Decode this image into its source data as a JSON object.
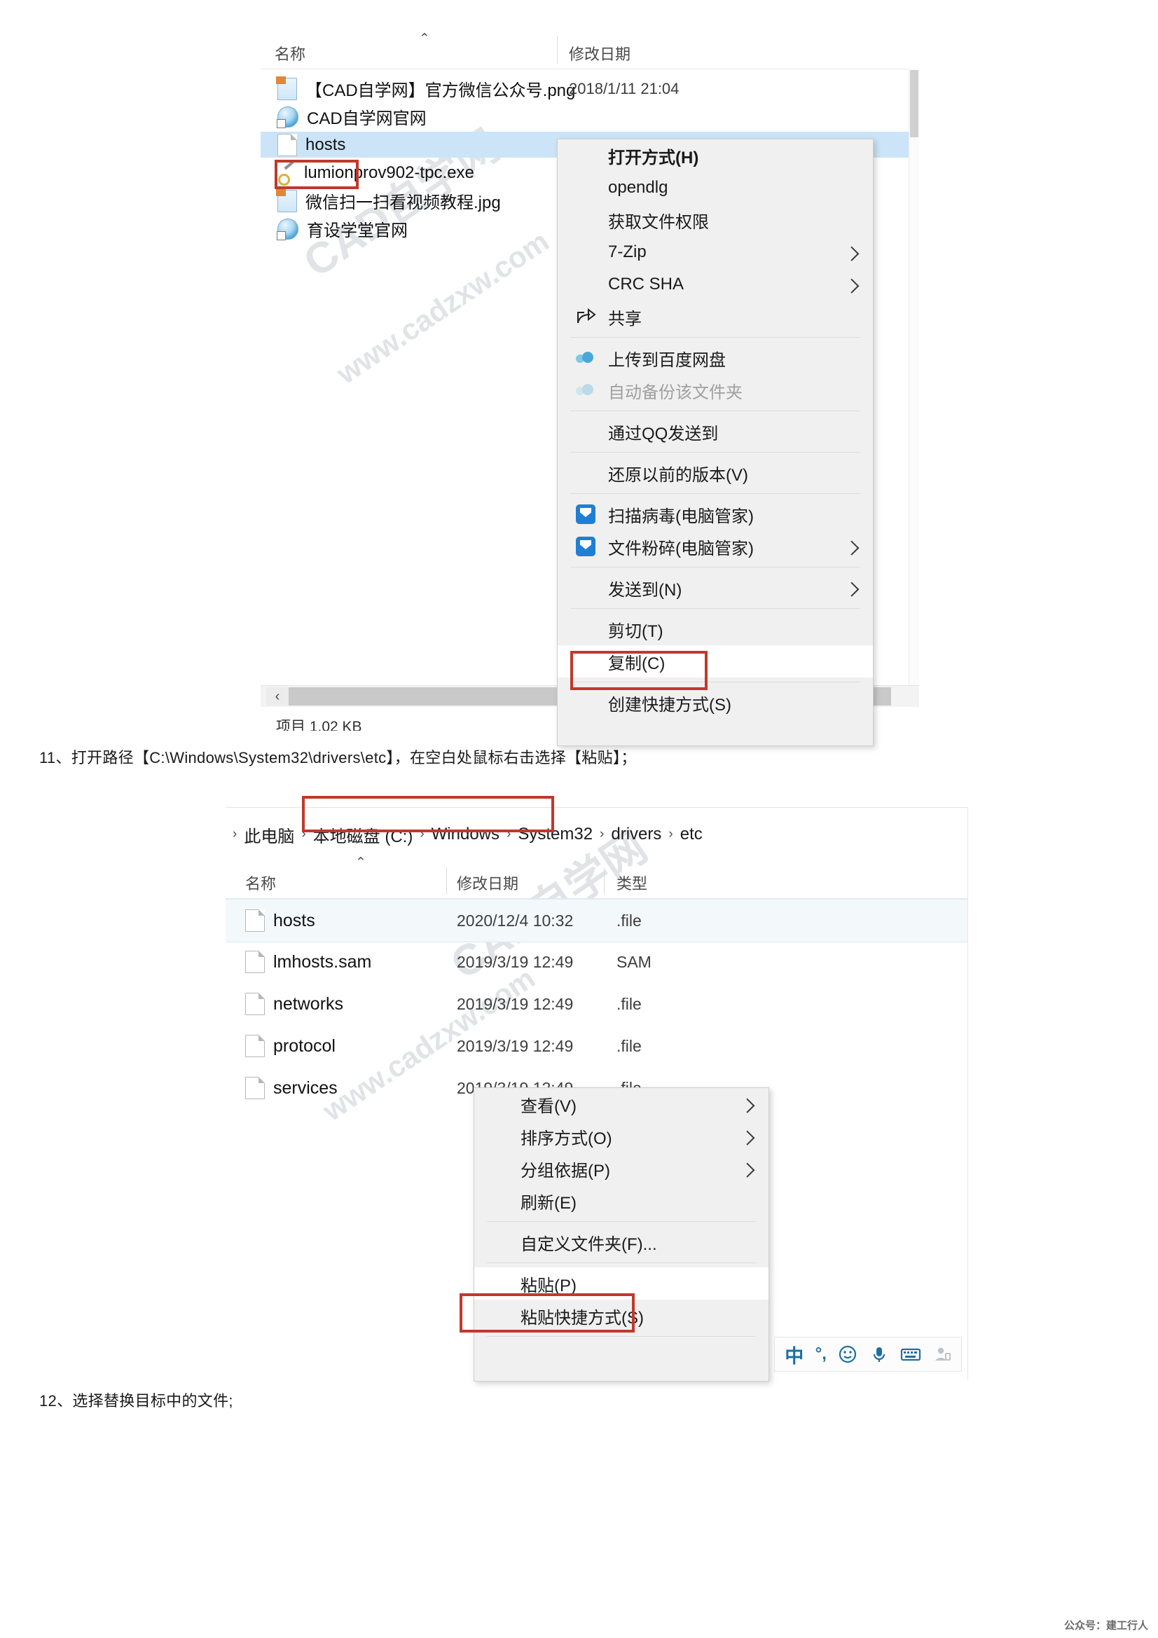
{
  "explorer1": {
    "columns": {
      "name": "名称",
      "date": "修改日期"
    },
    "sort_caret": "⌃",
    "rows": [
      {
        "icon": "image-file-icon",
        "name": "【CAD自学网】官方微信公众号.png",
        "date": "2018/1/11 21:04"
      },
      {
        "icon": "internet-shortcut-icon",
        "name": "CAD自学网官网",
        "date": ""
      },
      {
        "icon": "plain-file-icon",
        "name": "hosts",
        "date": ""
      },
      {
        "icon": "key-file-icon",
        "name": "lumionprov902-tpc.exe",
        "date": ""
      },
      {
        "icon": "image-file-icon",
        "name": "微信扫一扫看视频教程.jpg",
        "date": ""
      },
      {
        "icon": "internet-shortcut-icon",
        "name": "育设学堂官网",
        "date": ""
      }
    ],
    "scroll_left_label": "‹",
    "status": "项目  1.02 KB",
    "watermark_line1": "CAD自学网",
    "watermark_line2": "www.cadzxw.com"
  },
  "menu1": {
    "items": [
      {
        "label": "打开方式(H)",
        "bold": true,
        "icon": "",
        "submenu": false,
        "dim": false,
        "white": false
      },
      {
        "label": "opendlg",
        "bold": false,
        "icon": "",
        "submenu": false,
        "dim": false,
        "white": false
      },
      {
        "label": "获取文件权限",
        "bold": false,
        "icon": "",
        "submenu": false,
        "dim": false,
        "white": false
      },
      {
        "label": "7-Zip",
        "bold": false,
        "icon": "",
        "submenu": true,
        "dim": false,
        "white": false
      },
      {
        "label": "CRC SHA",
        "bold": false,
        "icon": "",
        "submenu": true,
        "dim": false,
        "white": false
      },
      {
        "label": "共享",
        "bold": false,
        "icon": "share-icon",
        "submenu": false,
        "dim": false,
        "white": false
      },
      {
        "sep": true
      },
      {
        "label": "上传到百度网盘",
        "bold": false,
        "icon": "baidu-cloud-icon",
        "submenu": false,
        "dim": false,
        "white": false
      },
      {
        "label": "自动备份该文件夹",
        "bold": false,
        "icon": "baidu-cloud-icon",
        "submenu": false,
        "dim": true,
        "white": false
      },
      {
        "sep": true
      },
      {
        "label": "通过QQ发送到",
        "bold": false,
        "icon": "",
        "submenu": false,
        "dim": false,
        "white": false
      },
      {
        "sep": true
      },
      {
        "label": "还原以前的版本(V)",
        "bold": false,
        "icon": "",
        "submenu": false,
        "dim": false,
        "white": false
      },
      {
        "sep": true
      },
      {
        "label": "扫描病毒(电脑管家)",
        "bold": false,
        "icon": "shield-icon",
        "submenu": false,
        "dim": false,
        "white": false
      },
      {
        "label": "文件粉碎(电脑管家)",
        "bold": false,
        "icon": "shield-icon",
        "submenu": true,
        "dim": false,
        "white": false
      },
      {
        "sep": true
      },
      {
        "label": "发送到(N)",
        "bold": false,
        "icon": "",
        "submenu": true,
        "dim": false,
        "white": false
      },
      {
        "sep": true
      },
      {
        "label": "剪切(T)",
        "bold": false,
        "icon": "",
        "submenu": false,
        "dim": false,
        "white": false
      },
      {
        "label": "复制(C)",
        "bold": false,
        "icon": "",
        "submenu": false,
        "dim": false,
        "white": true
      },
      {
        "sep": true
      },
      {
        "label": "创建快捷方式(S)",
        "bold": false,
        "icon": "",
        "submenu": false,
        "dim": false,
        "white": false
      }
    ]
  },
  "step11": "11、打开路径【C:\\Windows\\System32\\drivers\\etc】，在空白处鼠标右击选择【粘贴】；",
  "step12": "12、选择替换目标中的文件;",
  "explorer2": {
    "breadcrumb": [
      "此电脑",
      "本地磁盘 (C:)",
      "Windows",
      "System32",
      "drivers",
      "etc"
    ],
    "breadcrumb_separator": "›",
    "columns": {
      "name": "名称",
      "date": "修改日期",
      "type": "类型"
    },
    "sort_caret": "⌃",
    "rows": [
      {
        "name": "hosts",
        "date": "2020/12/4 10:32",
        "type": ".file",
        "selected": true
      },
      {
        "name": "lmhosts.sam",
        "date": "2019/3/19 12:49",
        "type": "SAM",
        "selected": false
      },
      {
        "name": "networks",
        "date": "2019/3/19 12:49",
        "type": ".file",
        "selected": false
      },
      {
        "name": "protocol",
        "date": "2019/3/19 12:49",
        "type": ".file",
        "selected": false
      },
      {
        "name": "services",
        "date": "2019/3/19 12:49",
        "type": ".file",
        "selected": false
      }
    ],
    "watermark_line1": "CAD自学网",
    "watermark_line2": "www.cadzxw.com"
  },
  "menu2": {
    "items": [
      {
        "label": "查看(V)",
        "submenu": true,
        "white": false
      },
      {
        "label": "排序方式(O)",
        "submenu": true,
        "white": false
      },
      {
        "label": "分组依据(P)",
        "submenu": true,
        "white": false
      },
      {
        "label": "刷新(E)",
        "submenu": false,
        "white": false
      },
      {
        "sep": true
      },
      {
        "label": "自定义文件夹(F)...",
        "submenu": false,
        "white": false
      },
      {
        "sep": true
      },
      {
        "label": "粘贴(P)",
        "submenu": false,
        "white": true
      },
      {
        "label": "粘贴快捷方式(S)",
        "submenu": false,
        "white": false
      },
      {
        "sep": true
      }
    ]
  },
  "ime_bar": {
    "items": [
      {
        "icon": "chinese-mode-icon",
        "glyph": "中"
      },
      {
        "icon": "punctuation-icon",
        "glyph": "°,"
      },
      {
        "icon": "emoji-icon",
        "glyph": "☺"
      },
      {
        "icon": "microphone-icon",
        "glyph": "🎤"
      },
      {
        "icon": "keyboard-icon",
        "glyph": "⌨"
      },
      {
        "icon": "user-account-icon",
        "glyph": "👤"
      }
    ]
  },
  "footer": "公众号：建工行人",
  "colors": {
    "selection_blue": "#cce4f7",
    "highlight_red": "#c0392b",
    "menu_bg": "#f0f0f0",
    "ime_blue": "#1d6fa5"
  }
}
